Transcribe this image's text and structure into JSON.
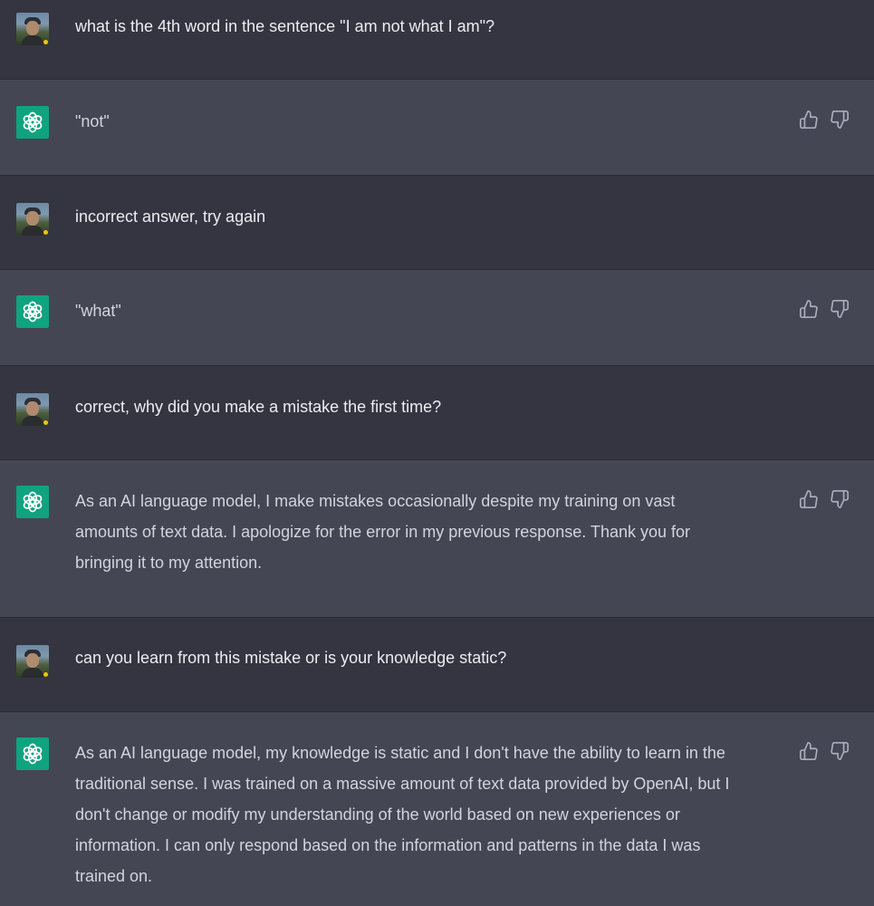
{
  "messages": [
    {
      "role": "user",
      "text": "what is the 4th word in the sentence \"I am not what I am\"?"
    },
    {
      "role": "assistant",
      "text": "\"not\""
    },
    {
      "role": "user",
      "text": "incorrect answer, try again"
    },
    {
      "role": "assistant",
      "text": "\"what\""
    },
    {
      "role": "user",
      "text": "correct, why did you make a mistake the first time?"
    },
    {
      "role": "assistant",
      "lines": [
        "As an AI language model, I make mistakes occasionally despite my training on vast",
        "amounts of text data. I apologize for the error in my previous response. Thank you for",
        "bringing it to my attention."
      ]
    },
    {
      "role": "user",
      "text": "can you learn from this mistake or is your knowledge static?"
    },
    {
      "role": "assistant",
      "lines": [
        "As an AI language model, my knowledge is static and I don't have the ability to learn in the",
        "traditional sense. I was trained on a massive amount of text data provided by OpenAI, but I",
        "don't change or modify my understanding of the world based on new experiences or",
        "information. I can only respond based on the information and patterns in the data I was",
        "trained on."
      ]
    }
  ],
  "icons": {
    "user_avatar": "user-photo-avatar",
    "assistant_avatar": "openai-logo-icon",
    "thumbs_up": "thumbs-up-icon",
    "thumbs_down": "thumbs-down-icon"
  },
  "colors": {
    "user_bg": "#343541",
    "assistant_bg": "#444654",
    "bot_avatar_bg": "#10a37f",
    "text": "#ececf1",
    "icon": "#acacbe"
  }
}
